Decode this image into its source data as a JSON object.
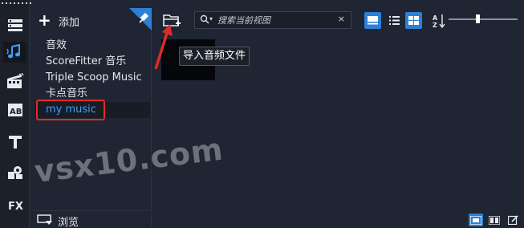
{
  "library": {
    "add_label": "添加",
    "items": [
      {
        "label": "音效"
      },
      {
        "label": "ScoreFitter 音乐"
      },
      {
        "label": "Triple Scoop Music"
      },
      {
        "label": "卡点音乐"
      },
      {
        "label": "my music"
      }
    ],
    "selected_index": 4,
    "browse_label": "浏览"
  },
  "toolbar": {
    "search_placeholder": "搜索当前视图",
    "clear_symbol": "×"
  },
  "content": {
    "tooltip": "导入音频文件"
  },
  "watermark": "vsx10.com",
  "colors": {
    "accent": "#2e7fd6",
    "selected_text": "#3aa0ff",
    "highlight_box": "#e02a2a",
    "background": "#1f2532"
  }
}
